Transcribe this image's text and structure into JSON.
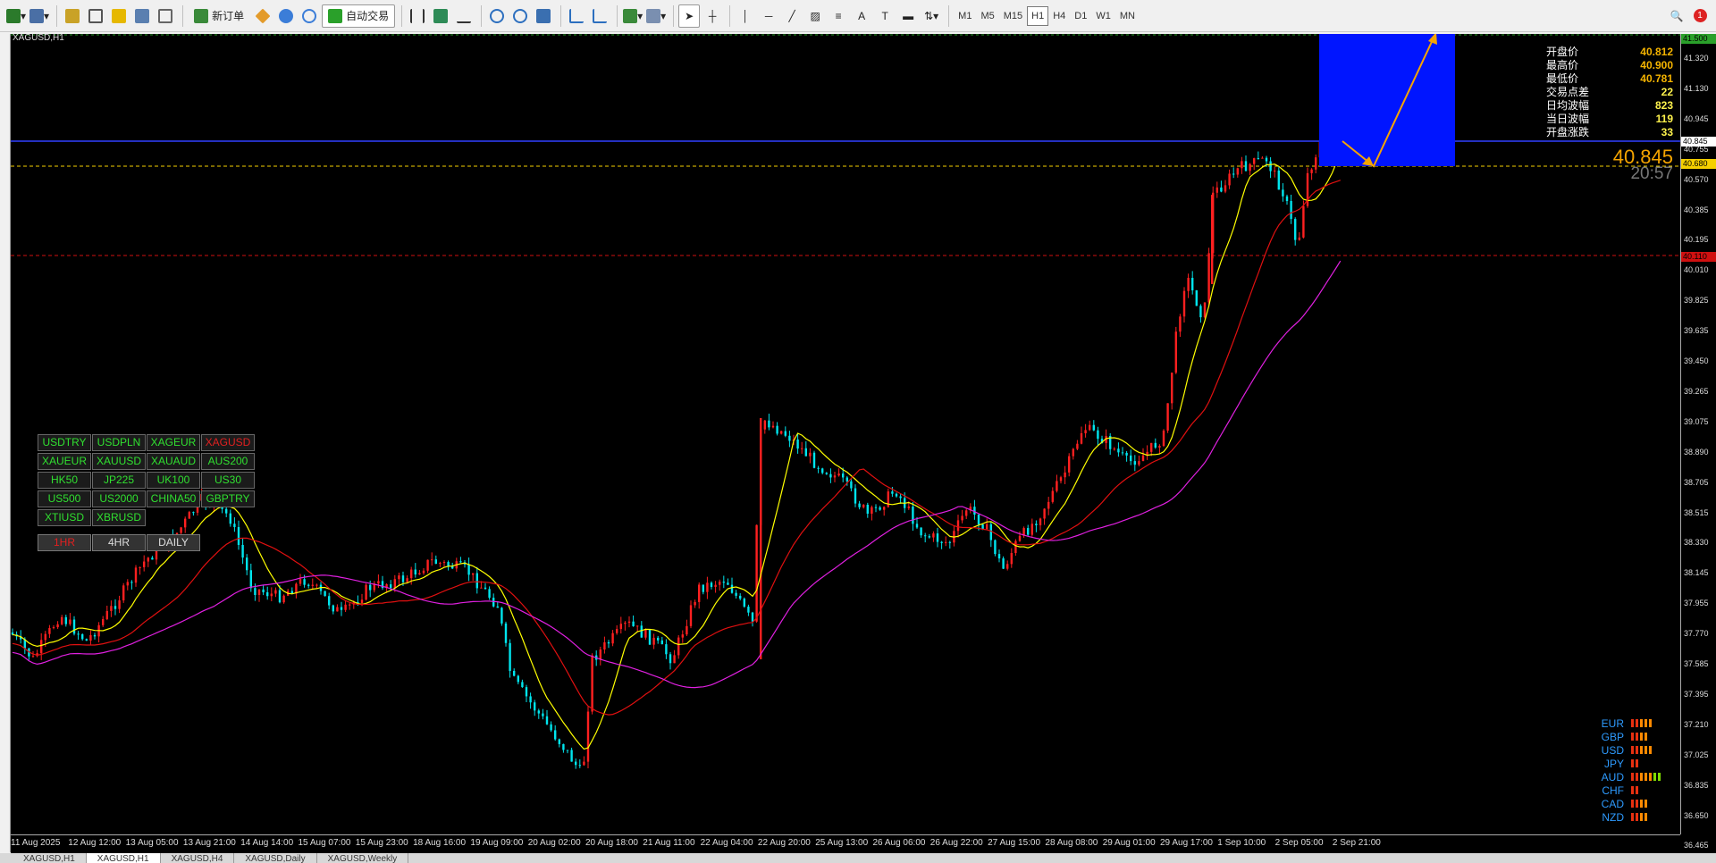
{
  "toolbar": {
    "new_order_label": "新订单",
    "auto_trade_label": "自动交易",
    "timeframes": [
      "M1",
      "M5",
      "M15",
      "H1",
      "H4",
      "D1",
      "W1",
      "MN"
    ],
    "active_timeframe": "H1",
    "notification_count": "1"
  },
  "chart": {
    "symbol_title": "XAGUSD,H1",
    "current_price": "40.845",
    "countdown": "20:57",
    "colors": {
      "bull_candle": "#ff2020",
      "bear_candle": "#00e5ee",
      "ma_fast": "#ffff00",
      "ma_mid": "#e01010",
      "ma_slow": "#e020e0",
      "zone": "#0015ff",
      "arrow": "#f5a400"
    }
  },
  "info_panel": [
    {
      "label": "开盘价",
      "value": "40.812"
    },
    {
      "label": "最高价",
      "value": "40.900"
    },
    {
      "label": "最低价",
      "value": "40.781"
    },
    {
      "label": "交易点差",
      "value": "22"
    },
    {
      "label": "日均波幅",
      "value": "823"
    },
    {
      "label": "当日波幅",
      "value": "119"
    },
    {
      "label": "开盘涨跌",
      "value": "33"
    }
  ],
  "symbol_buttons": [
    {
      "label": "USDTRY",
      "color": "green"
    },
    {
      "label": "USDPLN",
      "color": "green"
    },
    {
      "label": "XAGEUR",
      "color": "green"
    },
    {
      "label": "XAGUSD",
      "color": "red"
    },
    {
      "label": "XAUEUR",
      "color": "green"
    },
    {
      "label": "XAUUSD",
      "color": "green"
    },
    {
      "label": "XAUAUD",
      "color": "green"
    },
    {
      "label": "AUS200",
      "color": "green"
    },
    {
      "label": "HK50",
      "color": "green"
    },
    {
      "label": "JP225",
      "color": "green"
    },
    {
      "label": "UK100",
      "color": "green"
    },
    {
      "label": "US30",
      "color": "green"
    },
    {
      "label": "US500",
      "color": "green"
    },
    {
      "label": "US2000",
      "color": "green"
    },
    {
      "label": "CHINA50",
      "color": "green"
    },
    {
      "label": "GBPTRY",
      "color": "green"
    },
    {
      "label": "XTIUSD",
      "color": "green"
    },
    {
      "label": "XBRUSD",
      "color": "green"
    }
  ],
  "timeframe_buttons": [
    {
      "label": "1HR",
      "color": "red"
    },
    {
      "label": "4HR",
      "color": "white"
    },
    {
      "label": "DAILY",
      "color": "white"
    }
  ],
  "currency_strength": [
    {
      "currency": "EUR",
      "level": 5
    },
    {
      "currency": "GBP",
      "level": 4
    },
    {
      "currency": "USD",
      "level": 5
    },
    {
      "currency": "JPY",
      "level": 2
    },
    {
      "currency": "AUD",
      "level": 7
    },
    {
      "currency": "CHF",
      "level": 2
    },
    {
      "currency": "CAD",
      "level": 4
    },
    {
      "currency": "NZD",
      "level": 4
    }
  ],
  "price_axis": {
    "ticks": [
      "41.320",
      "41.130",
      "40.945",
      "40.755",
      "40.570",
      "40.385",
      "40.195",
      "40.010",
      "39.825",
      "39.635",
      "39.450",
      "39.265",
      "39.075",
      "38.890",
      "38.705",
      "38.515",
      "38.330",
      "38.145",
      "37.955",
      "37.770",
      "37.585",
      "37.395",
      "37.210",
      "37.025",
      "36.835",
      "36.650",
      "36.465"
    ],
    "tag_top": "41.500",
    "tag_current": "40.845",
    "tag_yellow": "40.680",
    "tag_red": "40.110"
  },
  "time_axis": [
    "11 Aug 2025",
    "12 Aug 12:00",
    "13 Aug 05:00",
    "13 Aug 21:00",
    "14 Aug 14:00",
    "15 Aug 07:00",
    "15 Aug 23:00",
    "18 Aug 16:00",
    "19 Aug 09:00",
    "20 Aug 02:00",
    "20 Aug 18:00",
    "21 Aug 11:00",
    "22 Aug 04:00",
    "22 Aug 20:00",
    "25 Aug 13:00",
    "26 Aug 06:00",
    "26 Aug 22:00",
    "27 Aug 15:00",
    "28 Aug 08:00",
    "29 Aug 01:00",
    "29 Aug 17:00",
    "1 Sep 10:00",
    "2 Sep 05:00",
    "2 Sep 21:00"
  ],
  "bottom_tabs": [
    "XAGUSD,H1",
    "XAGUSD,H1",
    "XAGUSD,H4",
    "XAGUSD,Daily",
    "XAGUSD,Weekly"
  ],
  "active_tab": 1
}
